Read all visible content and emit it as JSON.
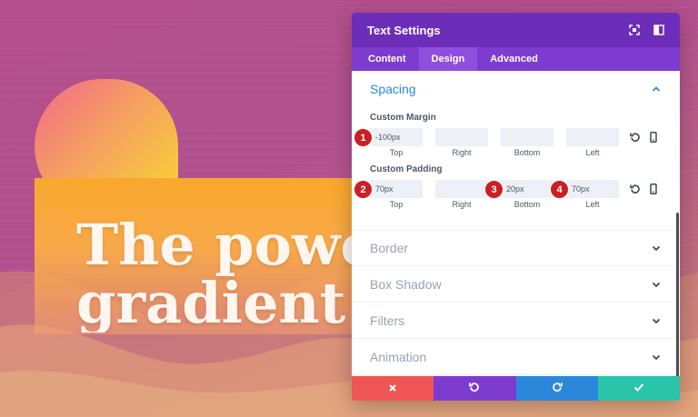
{
  "background": {
    "hero_lines": [
      "The power",
      "gradient"
    ]
  },
  "modal": {
    "title": "Text Settings",
    "header_icons": [
      "expand-icon",
      "sidebar-icon"
    ],
    "tabs": [
      {
        "label": "Content",
        "active": false
      },
      {
        "label": "Design",
        "active": true
      },
      {
        "label": "Advanced",
        "active": false
      }
    ],
    "spacing": {
      "title": "Spacing",
      "margin": {
        "label": "Custom Margin",
        "fields": [
          {
            "side": "Top",
            "value": "-100px",
            "marker": "1"
          },
          {
            "side": "Right",
            "value": "",
            "marker": ""
          },
          {
            "side": "Bottom",
            "value": "",
            "marker": ""
          },
          {
            "side": "Left",
            "value": "",
            "marker": ""
          }
        ]
      },
      "padding": {
        "label": "Custom Padding",
        "fields": [
          {
            "side": "Top",
            "value": "70px",
            "marker": "2"
          },
          {
            "side": "Right",
            "value": "",
            "marker": ""
          },
          {
            "side": "Bottom",
            "value": "20px",
            "marker": "3"
          },
          {
            "side": "Left",
            "value": "70px",
            "marker": "4"
          }
        ]
      }
    },
    "collapsed_groups": [
      "Border",
      "Box Shadow",
      "Filters",
      "Animation"
    ],
    "footer": {
      "buttons": [
        {
          "name": "cancel",
          "icon": "close-icon",
          "color": "#ef5555"
        },
        {
          "name": "undo",
          "icon": "undo-icon",
          "color": "#7e3bd0"
        },
        {
          "name": "redo",
          "icon": "redo-icon",
          "color": "#2b87da"
        },
        {
          "name": "save",
          "icon": "check-icon",
          "color": "#29c4a9"
        }
      ]
    }
  },
  "colors": {
    "header": "#6c2eb9",
    "tabs": "#7d3bcf",
    "active_group": "#2b87da",
    "marker": "#cc1f24"
  }
}
